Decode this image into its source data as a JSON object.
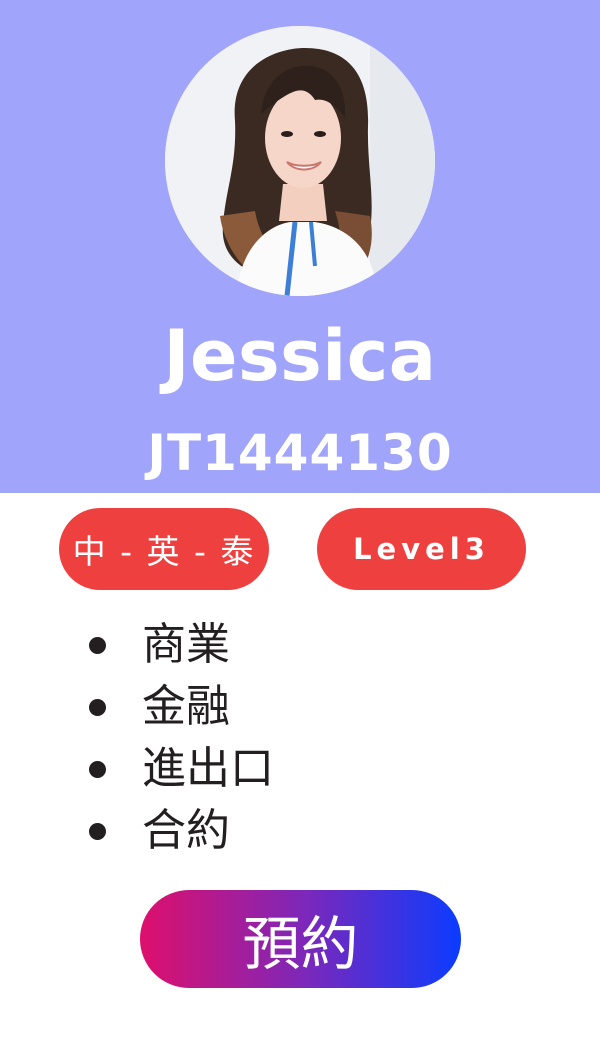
{
  "profile": {
    "name": "Jessica",
    "code": "JT1444130"
  },
  "tags": {
    "languages": "中 - 英 - 泰",
    "level": "Level3"
  },
  "topics": [
    "商業",
    "金融",
    "進出口",
    "合約"
  ],
  "actions": {
    "book_label": "預約"
  },
  "colors": {
    "header_bg": "#a0a4fb",
    "tag_red": "#ef4040",
    "text_dark": "#231f20",
    "gradient_start": "#de0f6c",
    "gradient_end": "#0b3cff"
  }
}
